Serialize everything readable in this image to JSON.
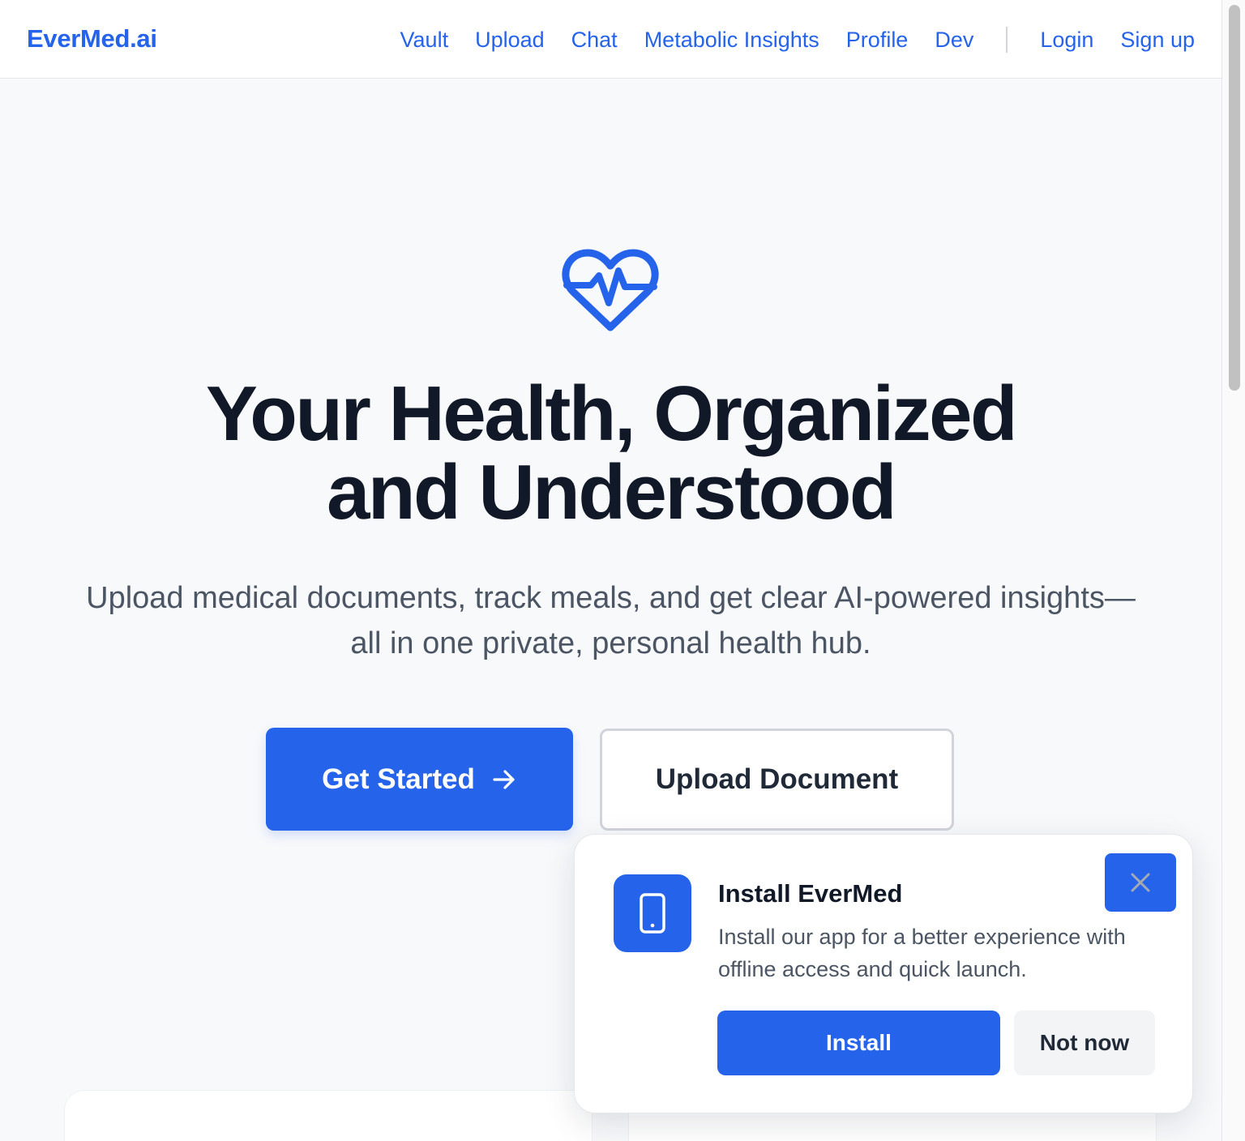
{
  "header": {
    "brand": "EverMed.ai",
    "nav": [
      "Vault",
      "Upload",
      "Chat",
      "Metabolic Insights",
      "Profile",
      "Dev"
    ],
    "login": "Login",
    "signup": "Sign up"
  },
  "hero": {
    "icon": "heart-pulse-icon",
    "title_line1": "Your Health, Organized",
    "title_line2": "and Understood",
    "subtitle_line1": "Upload medical documents, track meals, and get clear AI-powered insights—",
    "subtitle_line2": "all in one private, personal health hub.",
    "primary_cta": "Get Started",
    "secondary_cta": "Upload Document"
  },
  "install_prompt": {
    "icon": "mobile-device-icon",
    "title": "Install EverMed",
    "description": "Install our app for a better experience with offline access and quick launch.",
    "install_label": "Install",
    "dismiss_label": "Not now"
  },
  "colors": {
    "accent": "#2563eb",
    "text_dark": "#111827",
    "text_muted": "#4b5563",
    "background": "#f8f9fb"
  }
}
